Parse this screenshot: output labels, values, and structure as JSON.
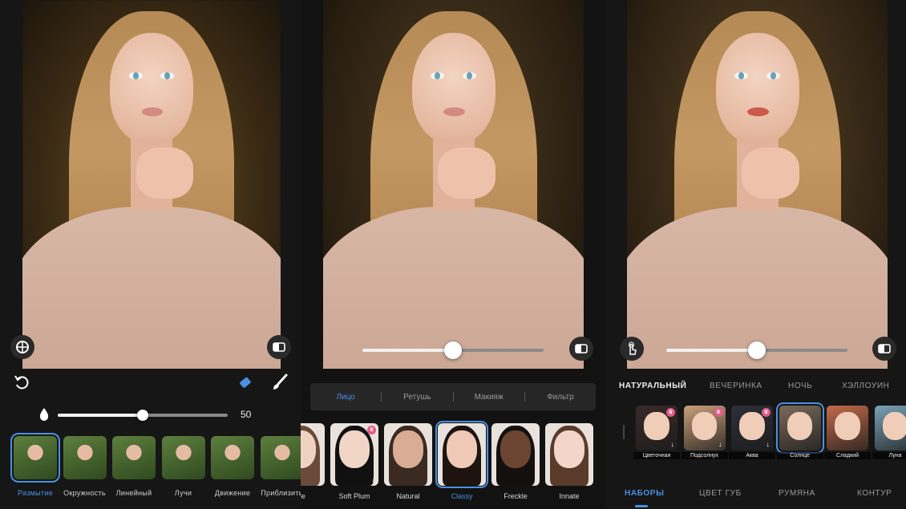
{
  "panel_blur": {
    "tools": {
      "undo_icon": "undo-icon",
      "eraser_icon": "eraser-icon",
      "brush_icon": "brush-icon"
    },
    "intensity": {
      "value": "50",
      "level": 0.5
    },
    "effects": [
      {
        "label": "Размытие",
        "selected": true
      },
      {
        "label": "Окружность",
        "selected": false
      },
      {
        "label": "Линейный",
        "selected": false
      },
      {
        "label": "Лучи",
        "selected": false
      },
      {
        "label": "Движение",
        "selected": false
      },
      {
        "label": "Приблизить",
        "selected": false
      }
    ]
  },
  "panel_makeup": {
    "slider_level": 0.5,
    "tabs": [
      {
        "label": "Лицо",
        "selected": true
      },
      {
        "label": "Ретушь",
        "selected": false
      },
      {
        "label": "Макияж",
        "selected": false
      },
      {
        "label": "Фильтр",
        "selected": false
      }
    ],
    "looks": [
      {
        "label": "kle",
        "selected": false
      },
      {
        "label": "Soft Plum",
        "selected": false
      },
      {
        "label": "Natural",
        "selected": false
      },
      {
        "label": "Classy",
        "selected": true
      },
      {
        "label": "Freckle",
        "selected": false
      },
      {
        "label": "Innate",
        "selected": false
      }
    ]
  },
  "panel_filters": {
    "slider_level": 0.5,
    "categories": [
      {
        "label": "НАТУРАЛЬНЫЙ",
        "selected": true
      },
      {
        "label": "ВЕЧЕРИНКА",
        "selected": false
      },
      {
        "label": "НОЧЬ",
        "selected": false
      },
      {
        "label": "ХЭЛЛОУИН",
        "selected": false
      }
    ],
    "filters": [
      {
        "label": "Цветочная",
        "selected": false
      },
      {
        "label": "Подсолнух",
        "selected": false
      },
      {
        "label": "Аква",
        "selected": false
      },
      {
        "label": "Солнце",
        "selected": true
      },
      {
        "label": "Сладкий",
        "selected": false
      },
      {
        "label": "Луна",
        "selected": false
      }
    ],
    "bottom_tabs": [
      {
        "label": "НАБОРЫ",
        "selected": true
      },
      {
        "label": "ЦВЕТ ГУБ",
        "selected": false
      },
      {
        "label": "РУМЯНА",
        "selected": false
      },
      {
        "label": "КОНТУР",
        "selected": false
      }
    ]
  }
}
